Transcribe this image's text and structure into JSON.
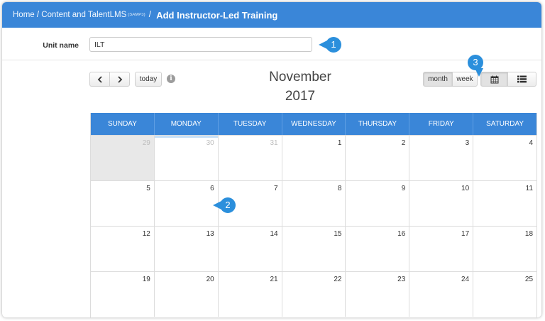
{
  "header": {
    "crumb_home": "Home",
    "crumb_sep1": " / ",
    "crumb_content": "Content and TalentLMS",
    "crumb_small": "(SAMP3)",
    "crumb_sep2": " / ",
    "title": "Add Instructor-Led Training"
  },
  "unit": {
    "label": "Unit name",
    "value": "ILT"
  },
  "callouts": {
    "one": "1",
    "two": "2",
    "three": "3"
  },
  "toolbar": {
    "prev_icon": "chevron-left-icon",
    "next_icon": "chevron-right-icon",
    "today_label": "today",
    "info_glyph": "i",
    "month_label": "month",
    "week_label": "week",
    "calendar_icon": "calendar-icon",
    "list_icon": "list-icon"
  },
  "calendar": {
    "title_month": "November",
    "title_year": "2017",
    "days": [
      "SUNDAY",
      "MONDAY",
      "TUESDAY",
      "WEDNESDAY",
      "THURSDAY",
      "FRIDAY",
      "SATURDAY"
    ],
    "weeks": [
      [
        "29",
        "30",
        "31",
        "1",
        "2",
        "3",
        "4"
      ],
      [
        "5",
        "6",
        "7",
        "8",
        "9",
        "10",
        "11"
      ],
      [
        "12",
        "13",
        "14",
        "15",
        "16",
        "17",
        "18"
      ],
      [
        "19",
        "20",
        "21",
        "22",
        "23",
        "24",
        "25"
      ]
    ]
  },
  "colors": {
    "header": "#3a86d8",
    "callout": "#2b8fdc"
  }
}
